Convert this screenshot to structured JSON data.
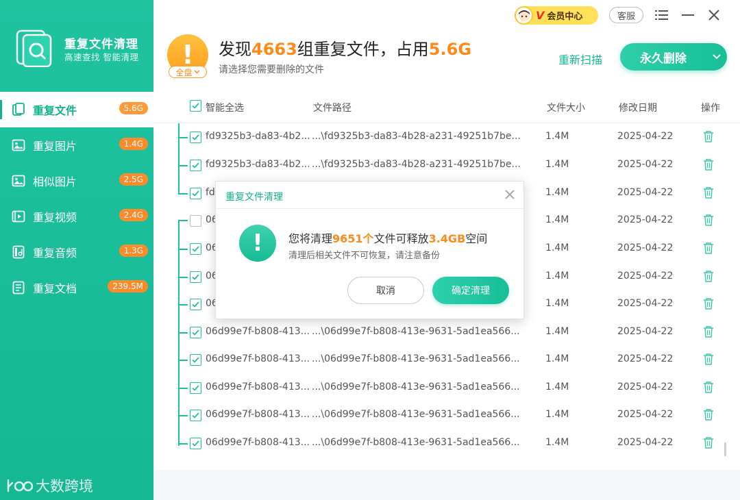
{
  "app": {
    "title": "重复文件清理",
    "subtitle": "高速查找 智能清理",
    "watermark": "大数跨境"
  },
  "sidebar": {
    "items": [
      {
        "label": "重复文件",
        "badge": "5.6G",
        "icon": "file-icon",
        "active": true
      },
      {
        "label": "重复图片",
        "badge": "1.4G",
        "icon": "image-icon",
        "active": false
      },
      {
        "label": "相似图片",
        "badge": "2.5G",
        "icon": "similar-image-icon",
        "active": false
      },
      {
        "label": "重复视频",
        "badge": "2.4G",
        "icon": "video-icon",
        "active": false
      },
      {
        "label": "重复音频",
        "badge": "1.3G",
        "icon": "audio-icon",
        "active": false
      },
      {
        "label": "重复文档",
        "badge": "239.5M",
        "icon": "document-icon",
        "active": false
      }
    ]
  },
  "topbar": {
    "vip_label": "会员中心",
    "vip_v": "V",
    "support_label": "客服"
  },
  "header": {
    "headline_prefix": "发现",
    "group_count": "4663",
    "headline_mid": "组重复文件，占用",
    "total_size": "5.6G",
    "subline": "请选择您需要删除的文件",
    "scope_label": "全盘",
    "rescan_label": "重新扫描",
    "delete_label": "永久删除"
  },
  "table": {
    "columns": {
      "select_all": "智能全选",
      "path": "文件路径",
      "size": "文件大小",
      "date": "修改日期",
      "action": "操作"
    },
    "rows": [
      {
        "name": "fd9325b3-da83-4b2...",
        "path": "...\\fd9325b3-da83-4b28-a231-49251b7be...",
        "size": "1.4M",
        "date": "2025-04-22",
        "checked": true
      },
      {
        "name": "fd9325b3-da83-4b2...",
        "path": "...\\fd9325b3-da83-4b28-a231-49251b7be...",
        "size": "1.4M",
        "date": "2025-04-22",
        "checked": true
      },
      {
        "name": "fd",
        "path": "",
        "size": "1.4M",
        "date": "2025-04-22",
        "checked": true
      },
      {
        "name": "06",
        "path": "",
        "size": "1.4M",
        "date": "2025-04-22",
        "checked": false
      },
      {
        "name": "06",
        "path": "",
        "size": "1.4M",
        "date": "2025-04-22",
        "checked": true
      },
      {
        "name": "06",
        "path": "",
        "size": "1.4M",
        "date": "2025-04-22",
        "checked": true
      },
      {
        "name": "06",
        "path": "",
        "size": "1.4M",
        "date": "2025-04-22",
        "checked": true
      },
      {
        "name": "06d99e7f-b808-413...",
        "path": "...\\06d99e7f-b808-413e-9631-5ad1ea566...",
        "size": "1.4M",
        "date": "2025-04-22",
        "checked": true
      },
      {
        "name": "06d99e7f-b808-413...",
        "path": "...\\06d99e7f-b808-413e-9631-5ad1ea566...",
        "size": "1.4M",
        "date": "2025-04-22",
        "checked": true
      },
      {
        "name": "06d99e7f-b808-413...",
        "path": "...\\06d99e7f-b808-413e-9631-5ad1ea566...",
        "size": "1.4M",
        "date": "2025-04-22",
        "checked": true
      },
      {
        "name": "06d99e7f-b808-413...",
        "path": "...\\06d99e7f-b808-413e-9631-5ad1ea566...",
        "size": "1.4M",
        "date": "2025-04-22",
        "checked": true
      },
      {
        "name": "06d99e7f-b808-413...",
        "path": "...\\06d99e7f-b808-413e-9631-5ad1ea566...",
        "size": "1.4M",
        "date": "2025-04-22",
        "checked": true
      }
    ]
  },
  "dialog": {
    "title": "重复文件清理",
    "msg_prefix": "您将清理",
    "file_count": "9651个",
    "msg_mid": "文件可释放",
    "free_size": "3.4GB",
    "msg_suffix": "空间",
    "tip": "清理后相关文件不可恢复，请注意备份",
    "cancel_label": "取消",
    "confirm_label": "确定清理"
  },
  "colors": {
    "accent": "#1fc3a0",
    "warning": "#ff8a1a",
    "badge": "#ff8a2a"
  }
}
